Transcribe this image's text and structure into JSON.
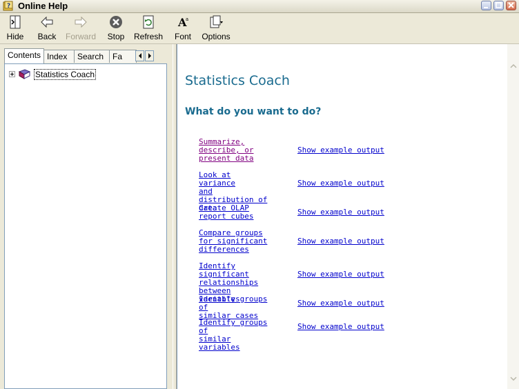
{
  "window": {
    "title": "Online Help"
  },
  "toolbar": {
    "buttons": [
      {
        "label": "Hide",
        "icon": "hide-icon",
        "enabled": true
      },
      {
        "label": "Back",
        "icon": "back-arrow-icon",
        "enabled": true
      },
      {
        "label": "Forward",
        "icon": "forward-arrow-icon",
        "enabled": false
      },
      {
        "label": "Stop",
        "icon": "stop-icon",
        "enabled": true
      },
      {
        "label": "Refresh",
        "icon": "refresh-icon",
        "enabled": true
      },
      {
        "label": "Font",
        "icon": "font-icon",
        "enabled": true
      },
      {
        "label": "Options",
        "icon": "options-icon",
        "enabled": true
      }
    ]
  },
  "nav_tabs": [
    {
      "label": "Contents",
      "active": true
    },
    {
      "label": "Index",
      "active": false
    },
    {
      "label": "Search",
      "active": false
    },
    {
      "label": "Fa",
      "active": false
    }
  ],
  "tree": {
    "items": [
      {
        "label": "Statistics Coach",
        "icon": "book-icon",
        "expanded": false,
        "selected": true
      }
    ]
  },
  "content": {
    "title": "Statistics Coach",
    "subtitle": "What do you want to do?",
    "tasks": [
      {
        "lines": [
          "Summarize,",
          "describe, or",
          "present data"
        ],
        "visited": true,
        "example": "Show example output"
      },
      {
        "lines": [
          "Look at variance",
          "and distribution of",
          "data"
        ],
        "visited": false,
        "example": "Show example output"
      },
      {
        "lines": [
          "Create OLAP",
          "report cubes"
        ],
        "visited": false,
        "example": "Show example output"
      },
      {
        "lines": [
          "Compare groups",
          "for significant",
          "differences"
        ],
        "visited": false,
        "example": "Show example output"
      },
      {
        "lines": [
          "Identify significant",
          "relationships",
          "between variables"
        ],
        "visited": false,
        "example": "Show example output"
      },
      {
        "lines": [
          "Identify groups of",
          "similar cases"
        ],
        "visited": false,
        "example": "Show example output"
      },
      {
        "lines": [
          "Identify groups of",
          "similar variables"
        ],
        "visited": false,
        "example": "Show example output"
      }
    ]
  },
  "colors": {
    "link": "#0000cc",
    "visited_link": "#800080",
    "heading": "#1a6b8f"
  }
}
